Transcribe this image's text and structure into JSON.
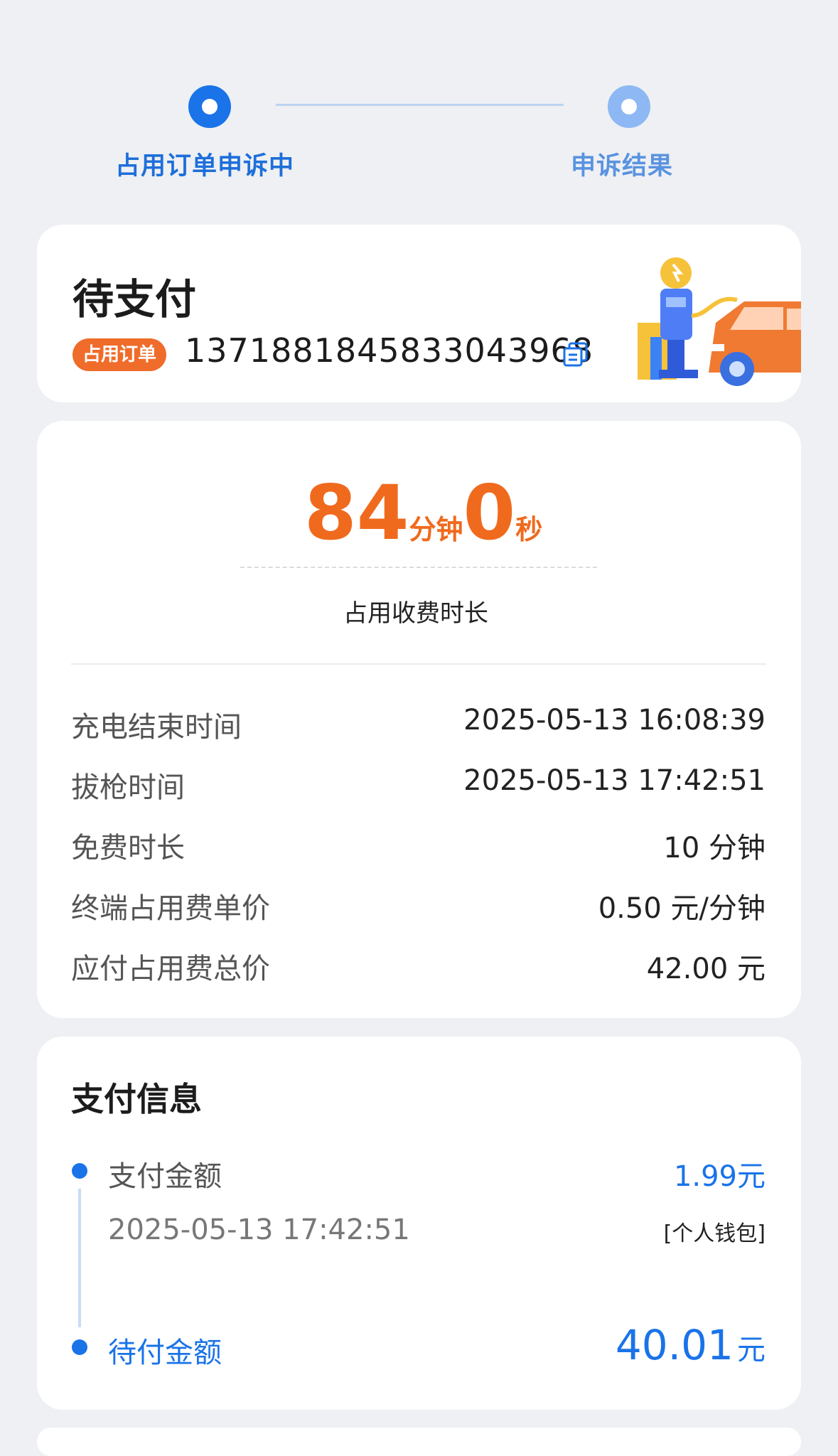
{
  "steps": [
    {
      "label": "占用订单申诉中",
      "state": "active"
    },
    {
      "label": "申诉结果",
      "state": "inactive"
    }
  ],
  "order": {
    "status": "待支付",
    "tag": "占用订单",
    "number": "13718818458330439​68",
    "copy_icon": "copy-icon",
    "illustration": "charging-station-car-illustration"
  },
  "duration": {
    "minutes": "84",
    "minutes_unit": "分钟",
    "seconds": "0",
    "seconds_unit": "秒",
    "label": "占用收费时长"
  },
  "details": [
    {
      "label": "充电结束时间",
      "value": "2025-05-13 16:08:39"
    },
    {
      "label": "拔枪时间",
      "value": "2025-05-13 17:42:51"
    },
    {
      "label": "免费时长",
      "value": "10 分钟"
    },
    {
      "label": "终端占用费单价",
      "value": "0.50 元/分钟"
    },
    {
      "label": "应付占用费总价",
      "value": "42.00 元"
    }
  ],
  "payment": {
    "title": "支付信息",
    "paid_label": "支付金额",
    "paid_value": "1.99元",
    "paid_time": "2025-05-13 17:42:51",
    "wallet": "[个人钱包]",
    "due_label": "待付金额",
    "due_amount": "40.01",
    "due_unit": "元"
  },
  "colors": {
    "accent": "#1a73e8",
    "orange": "#f06a1e",
    "background": "#eef0f4"
  }
}
